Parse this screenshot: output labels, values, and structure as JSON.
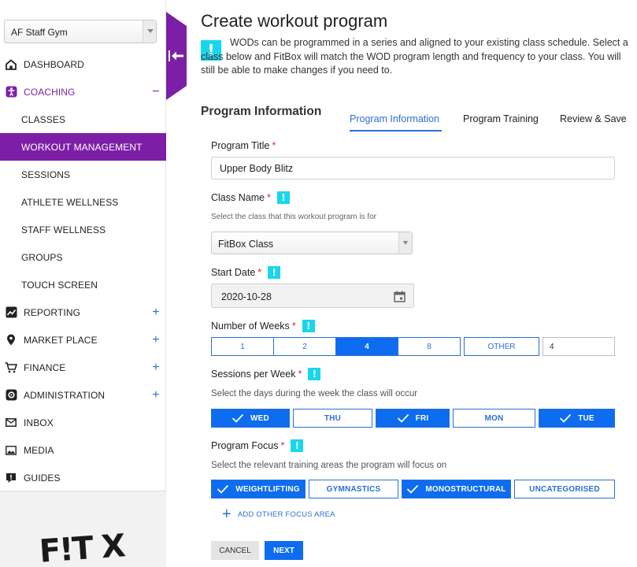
{
  "sidebar": {
    "gym_select": "AF Staff Gym",
    "items": [
      {
        "label": "DASHBOARD",
        "icon": "home-icon"
      },
      {
        "label": "COACHING",
        "icon": "person-icon",
        "toggle": "−"
      },
      {
        "label": "CLASSES"
      },
      {
        "label": "WORKOUT MANAGEMENT"
      },
      {
        "label": "SESSIONS"
      },
      {
        "label": "ATHLETE WELLNESS"
      },
      {
        "label": "STAFF WELLNESS"
      },
      {
        "label": "GROUPS"
      },
      {
        "label": "TOUCH SCREEN"
      },
      {
        "label": "REPORTING",
        "icon": "chart-line-icon",
        "toggle": "+"
      },
      {
        "label": "MARKET PLACE",
        "icon": "map-pin-icon",
        "toggle": "+"
      },
      {
        "label": "FINANCE",
        "icon": "cart-icon",
        "toggle": "+"
      },
      {
        "label": "ADMINISTRATION",
        "icon": "gear-icon",
        "toggle": "+"
      },
      {
        "label": "INBOX",
        "icon": "mail-icon"
      },
      {
        "label": "MEDIA",
        "icon": "image-icon"
      },
      {
        "label": "GUIDES",
        "icon": "guide-icon"
      }
    ],
    "logo_text": "F!T X",
    "colors": {
      "accent": "#7d1fa6"
    }
  },
  "main": {
    "title": "Create workout program",
    "intro": "WODs can be programmed in a series and aligned to your existing class schedule. Select a class below and FitBox will match the WOD program length and frequency to your class. You will still be able to make changes if you need to.",
    "section_heading": "Program Information",
    "tabs": [
      {
        "label": "Program Information",
        "active": true
      },
      {
        "label": "Program Training"
      },
      {
        "label": "Review & Save"
      }
    ],
    "form": {
      "program_title": {
        "label": "Program Title",
        "required": "*",
        "value": "Upper Body Blitz"
      },
      "class_name": {
        "label": "Class Name",
        "required": "*",
        "help": "Select the class that this workout program is for",
        "value": "FitBox Class"
      },
      "start_date": {
        "label": "Start Date",
        "required": "*",
        "value": "2020-10-28"
      },
      "weeks": {
        "label": "Number of Weeks",
        "required": "*",
        "options": [
          "1",
          "2",
          "4",
          "8",
          "OTHER"
        ],
        "selected": "4",
        "custom_value": "4"
      },
      "sessions": {
        "label": "Sessions per Week",
        "required": "*",
        "help": "Select the days during the week the class will occur",
        "days": [
          {
            "label": "WED",
            "on": true
          },
          {
            "label": "THU",
            "on": false
          },
          {
            "label": "FRI",
            "on": true
          },
          {
            "label": "MON",
            "on": false
          },
          {
            "label": "TUE",
            "on": true
          }
        ]
      },
      "focus": {
        "label": "Program Focus",
        "required": "*",
        "help": "Select the relevant training areas the program will focus on",
        "areas": [
          {
            "label": "WEIGHTLIFTING",
            "on": true
          },
          {
            "label": "GYMNASTICS",
            "on": false
          },
          {
            "label": "MONOSTRUCTURAL",
            "on": true
          },
          {
            "label": "UNCATEGORISED",
            "on": false
          }
        ],
        "add_label": "ADD OTHER FOCUS AREA"
      }
    },
    "buttons": {
      "cancel": "CANCEL",
      "next": "NEXT"
    },
    "colors": {
      "primary": "#0d6cf0",
      "info": "#19d6ee",
      "required": "#e0262b"
    }
  }
}
